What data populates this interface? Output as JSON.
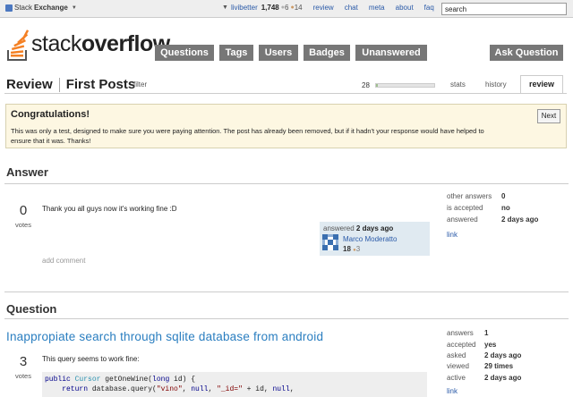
{
  "topbar": {
    "brand_prefix": "Stack",
    "brand_bold": "Exchange",
    "username": "livibetter",
    "reputation": "1,748",
    "silver_count": "6",
    "bronze_count": "14",
    "links": [
      "review",
      "chat",
      "meta",
      "about",
      "faq"
    ],
    "search_value": "search"
  },
  "logo": {
    "text_light": "stack",
    "text_bold": "overflow"
  },
  "nav": {
    "buttons": [
      "Questions",
      "Tags",
      "Users",
      "Badges",
      "Unanswered"
    ],
    "ask": "Ask Question"
  },
  "review": {
    "title": "Review",
    "subtitle": "First Posts",
    "filter": "filter",
    "progress_count": "28",
    "progress_fraction": 0.03,
    "tabs": [
      "stats",
      "history"
    ],
    "active_tab": "review"
  },
  "congrats": {
    "title": "Congratulations!",
    "message": "This was only a test, designed to make sure you were paying attention. The post has already been removed, but if it hadn't your response would have helped to ensure that it was. Thanks!",
    "next": "Next"
  },
  "answer": {
    "heading": "Answer",
    "votes": "0",
    "votes_label": "votes",
    "body": "Thank you all guys now it's working fine :D",
    "answered_label": "answered",
    "answered_time": "2 days ago",
    "user_name": "Marco Moderatto",
    "user_rep": "18",
    "user_bronze": "3",
    "add_comment": "add comment",
    "stats": [
      {
        "key": "other answers",
        "value": "0"
      },
      {
        "key": "is accepted",
        "value": "no"
      },
      {
        "key": "answered",
        "value": "2 days ago"
      }
    ],
    "link": "link"
  },
  "question": {
    "heading": "Question",
    "title": "Inappropiate search through sqlite database from android",
    "votes": "3",
    "votes_label": "votes",
    "body": "This query seems to work fine:",
    "code_line1": "public Cursor getOneWine(long id) {",
    "code_line2": "    return database.query(\"vino\", null, \"_id=\" + id, null,",
    "stats": [
      {
        "key": "answers",
        "value": "1"
      },
      {
        "key": "accepted",
        "value": "yes"
      },
      {
        "key": "asked",
        "value": "2 days ago"
      },
      {
        "key": "viewed",
        "value": "29 times"
      },
      {
        "key": "active",
        "value": "2 days ago"
      }
    ],
    "link": "link"
  },
  "colors": {
    "nav_button": "#777777",
    "link": "#2a5aa8",
    "question_title": "#2a7ec0",
    "congrats_bg": "#fdf7e2",
    "user_card_bg": "#e0eaf1"
  }
}
